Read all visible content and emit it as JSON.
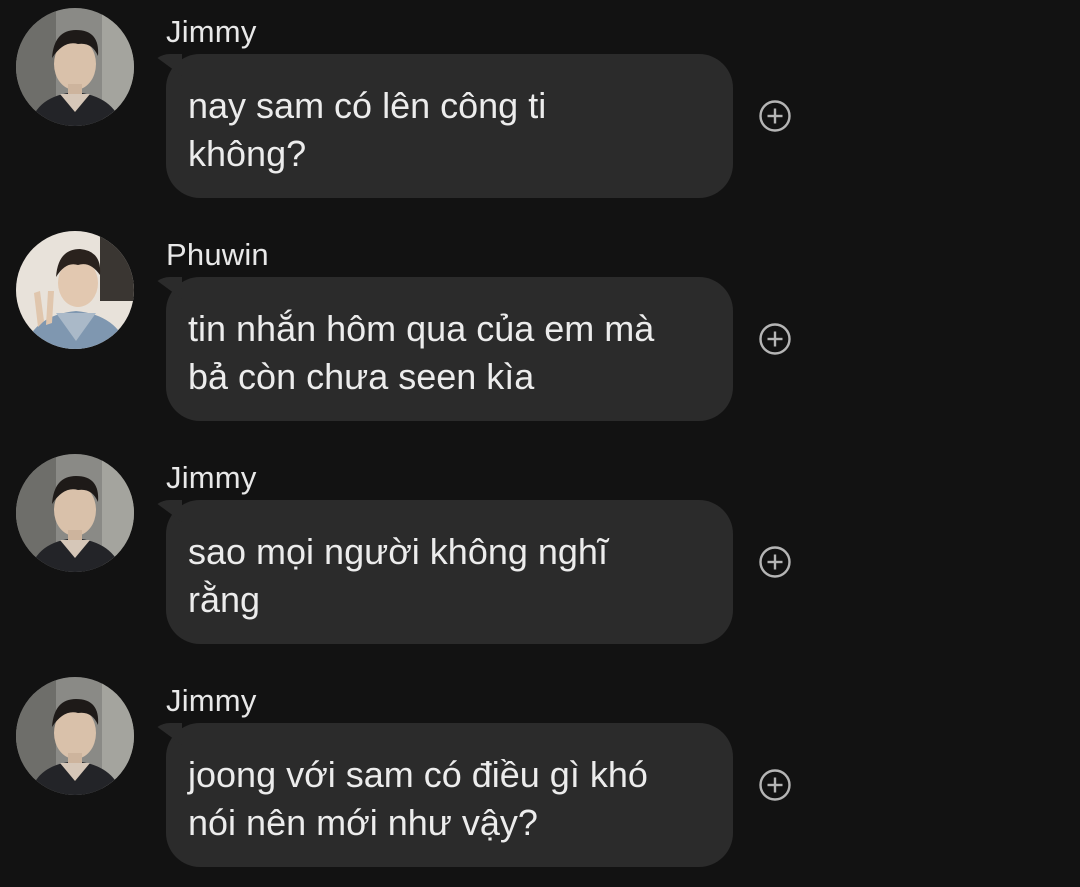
{
  "messages": [
    {
      "sender": "Jimmy",
      "text": "nay sam có lên công ti\nkhông?",
      "avatar": "jimmy-avatar"
    },
    {
      "sender": "Phuwin",
      "text": "tin nhắn hôm qua của em mà\nbả còn chưa seen kìa",
      "avatar": "phuwin-avatar"
    },
    {
      "sender": "Jimmy",
      "text": "sao mọi người không nghĩ\nrằng",
      "avatar": "jimmy-avatar"
    },
    {
      "sender": "Jimmy",
      "text": "joong với sam có điều gì khó\nnói nên mới như vậy?",
      "avatar": "jimmy-avatar"
    }
  ],
  "icons": {
    "react": "add-reaction-icon"
  },
  "colors": {
    "background": "#121212",
    "bubble": "#2b2b2b",
    "text": "#ececec",
    "icon": "#b5b5b5"
  }
}
